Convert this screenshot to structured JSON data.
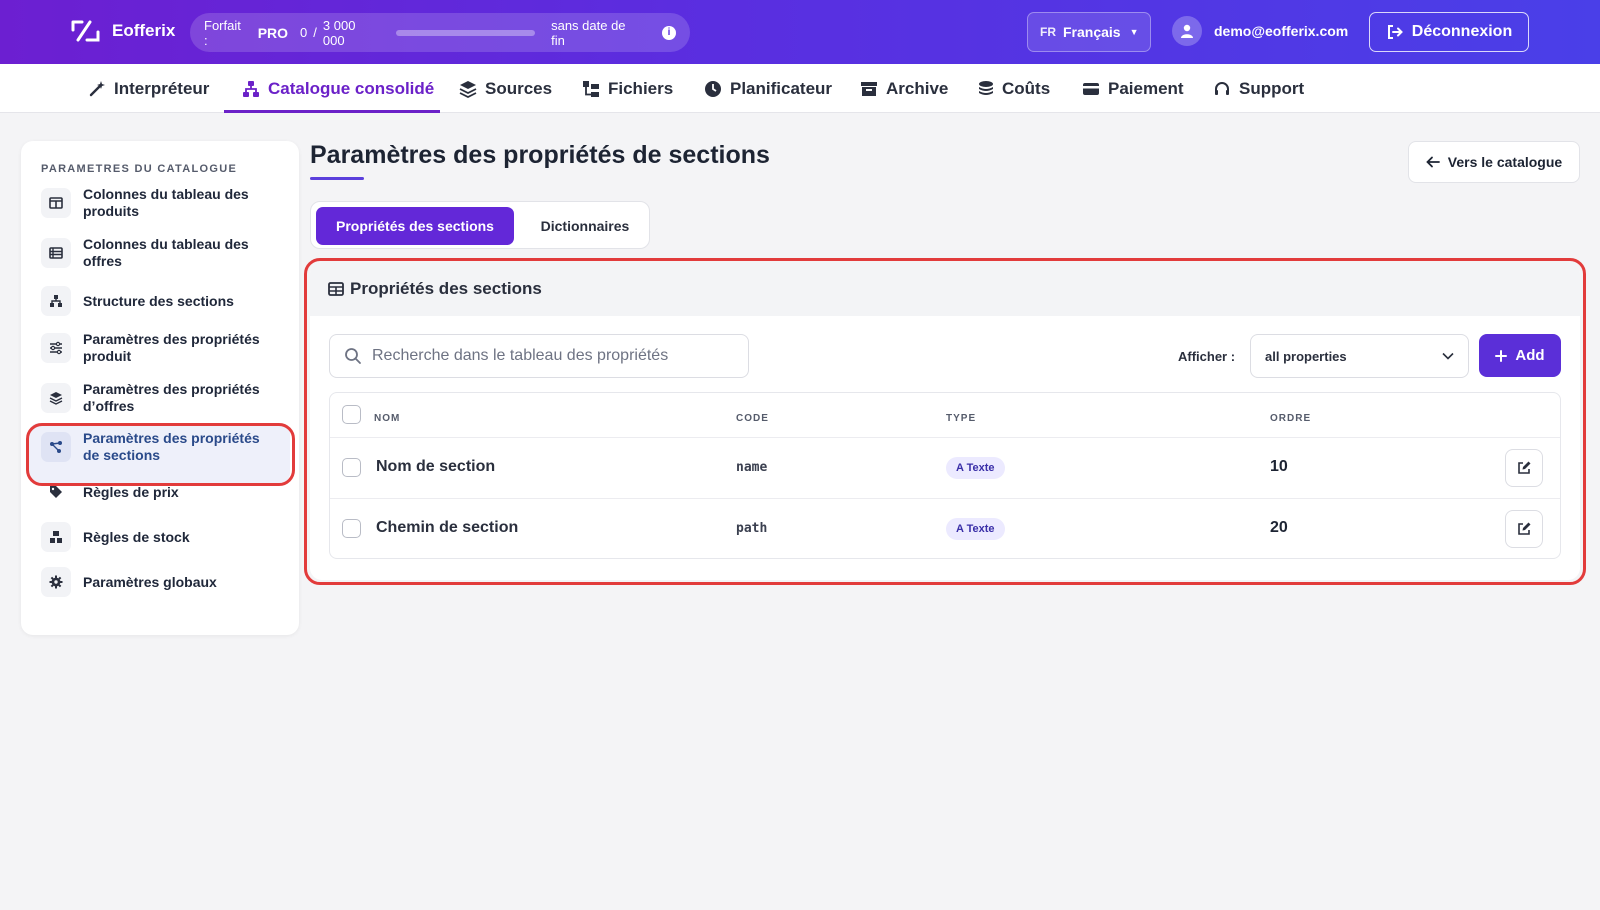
{
  "header": {
    "app_name": "Eofferix",
    "plan_label": "Forfait :",
    "plan_name": "PRO",
    "plan_usage": "0",
    "plan_separator": "/",
    "plan_limit": "3 000 000",
    "plan_end": "sans date de fin",
    "plan_progress": 0,
    "lang_code": "FR",
    "lang_name": "Français",
    "user_email": "demo@eofferix.com",
    "logout_label": "Déconnexion"
  },
  "nav": {
    "items": [
      {
        "label": "Interpréteur",
        "icon": "wand-icon"
      },
      {
        "label": "Catalogue consolidé",
        "icon": "sitemap-icon"
      },
      {
        "label": "Sources",
        "icon": "layers-icon"
      },
      {
        "label": "Fichiers",
        "icon": "folder-tree-icon"
      },
      {
        "label": "Planificateur",
        "icon": "clock-icon"
      },
      {
        "label": "Archive",
        "icon": "archive-icon"
      },
      {
        "label": "Coûts",
        "icon": "coins-icon"
      },
      {
        "label": "Paiement",
        "icon": "credit-card-icon"
      },
      {
        "label": "Support",
        "icon": "headset-icon"
      }
    ],
    "active_index": 1
  },
  "sidebar": {
    "heading": "PARAMETRES DU CATALOGUE",
    "items": [
      {
        "line1": "Colonnes du tableau des",
        "line2": "produits"
      },
      {
        "line1": "Colonnes du tableau des",
        "line2": "offres"
      },
      {
        "line1": "Structure des sections",
        "line2": ""
      },
      {
        "line1": "Paramètres des propriétés",
        "line2": "produit"
      },
      {
        "line1": "Paramètres des propriétés",
        "line2": "d’offres"
      },
      {
        "line1": "Paramètres des propriétés",
        "line2": "de sections"
      },
      {
        "line1": "Règles de prix",
        "line2": ""
      },
      {
        "line1": "Règles de stock",
        "line2": ""
      },
      {
        "line1": "Paramètres globaux",
        "line2": ""
      }
    ],
    "active_index": 5
  },
  "main": {
    "title": "Paramètres des propriétés de sections",
    "back_label": "Vers le catalogue",
    "tabs": [
      {
        "label": "Propriétés des sections"
      },
      {
        "label": "Dictionnaires"
      }
    ],
    "card_title": "Propriétés des sections",
    "search_placeholder": "Recherche dans le tableau des propriétés",
    "show_label": "Afficher :",
    "show_value": "all properties",
    "add_label": "Add",
    "table": {
      "columns": [
        "NOM",
        "CODE",
        "TYPE",
        "ORDRE"
      ],
      "rows": [
        {
          "name": "Nom de section",
          "code": "name",
          "type": "A Texte",
          "order": "10"
        },
        {
          "name": "Chemin de section",
          "code": "path",
          "type": "A Texte",
          "order": "20"
        }
      ]
    }
  },
  "colors": {
    "accent": "#6328d8",
    "highlight": "#e23b3b"
  }
}
